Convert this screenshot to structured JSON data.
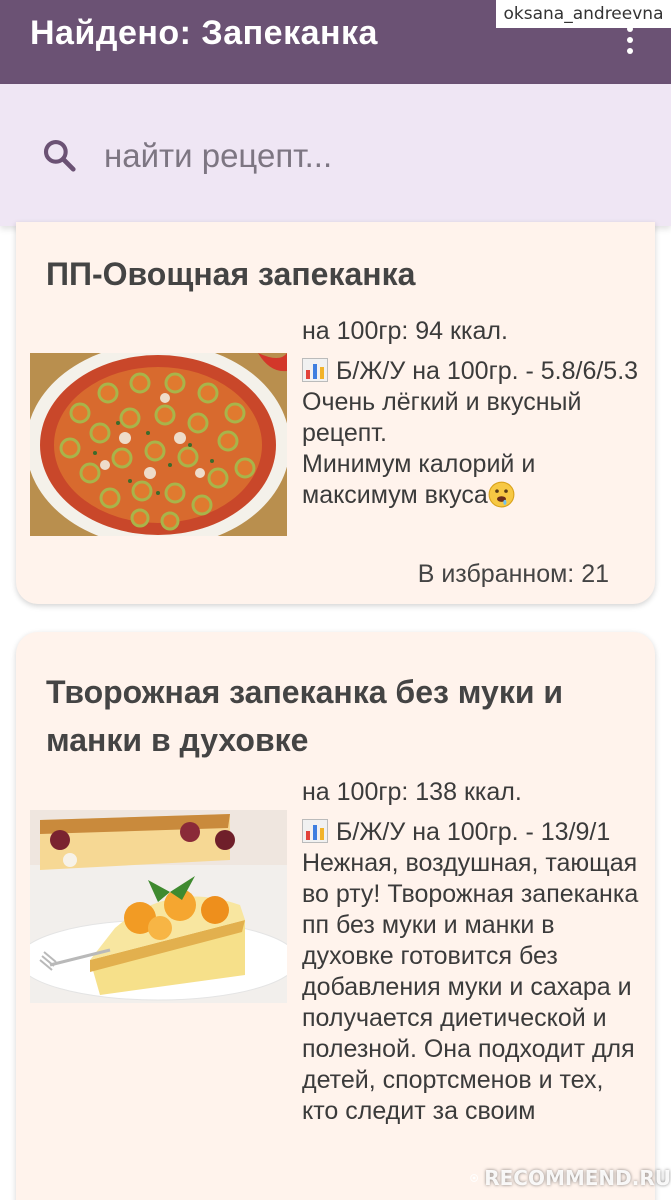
{
  "appbar": {
    "title": "Найдено: Запеканка",
    "menu_icon": "more-vert-icon",
    "bg_color": "#6b5274"
  },
  "watermark": {
    "user": "oksana_andreevna",
    "site": "RECOMMEND.RU"
  },
  "search": {
    "placeholder": "найти рецепт...",
    "value": "",
    "icon": "search-icon"
  },
  "recipes": [
    {
      "title": "ПП-Овощная запеканка",
      "kcal": "на 100гр: 94 ккал.",
      "bju": "Б/Ж/У на 100гр. - 5.8/6/5.3",
      "description": "Очень лёгкий и вкусный рецепт.",
      "description2": "Минимум калорий и максимум вкуса",
      "favorites": "В избранном: 21"
    },
    {
      "title": "Творожная запеканка без муки и манки в духовке",
      "kcal": "на 100гр: 138 ккал.",
      "bju": "Б/Ж/У на 100гр. - 13/9/1",
      "description": "Нежная, воздушная, тающая во рту! Творожная запеканка пп без муки и манки в духовке готовится без добавления муки и сахара и получается диетической и полезной. Она подходит для детей, спортсменов и тех, кто следит за своим"
    }
  ],
  "colors": {
    "card_bg": "#fff3ec",
    "search_bg": "#efe6f4",
    "accent": "#6b5274"
  }
}
